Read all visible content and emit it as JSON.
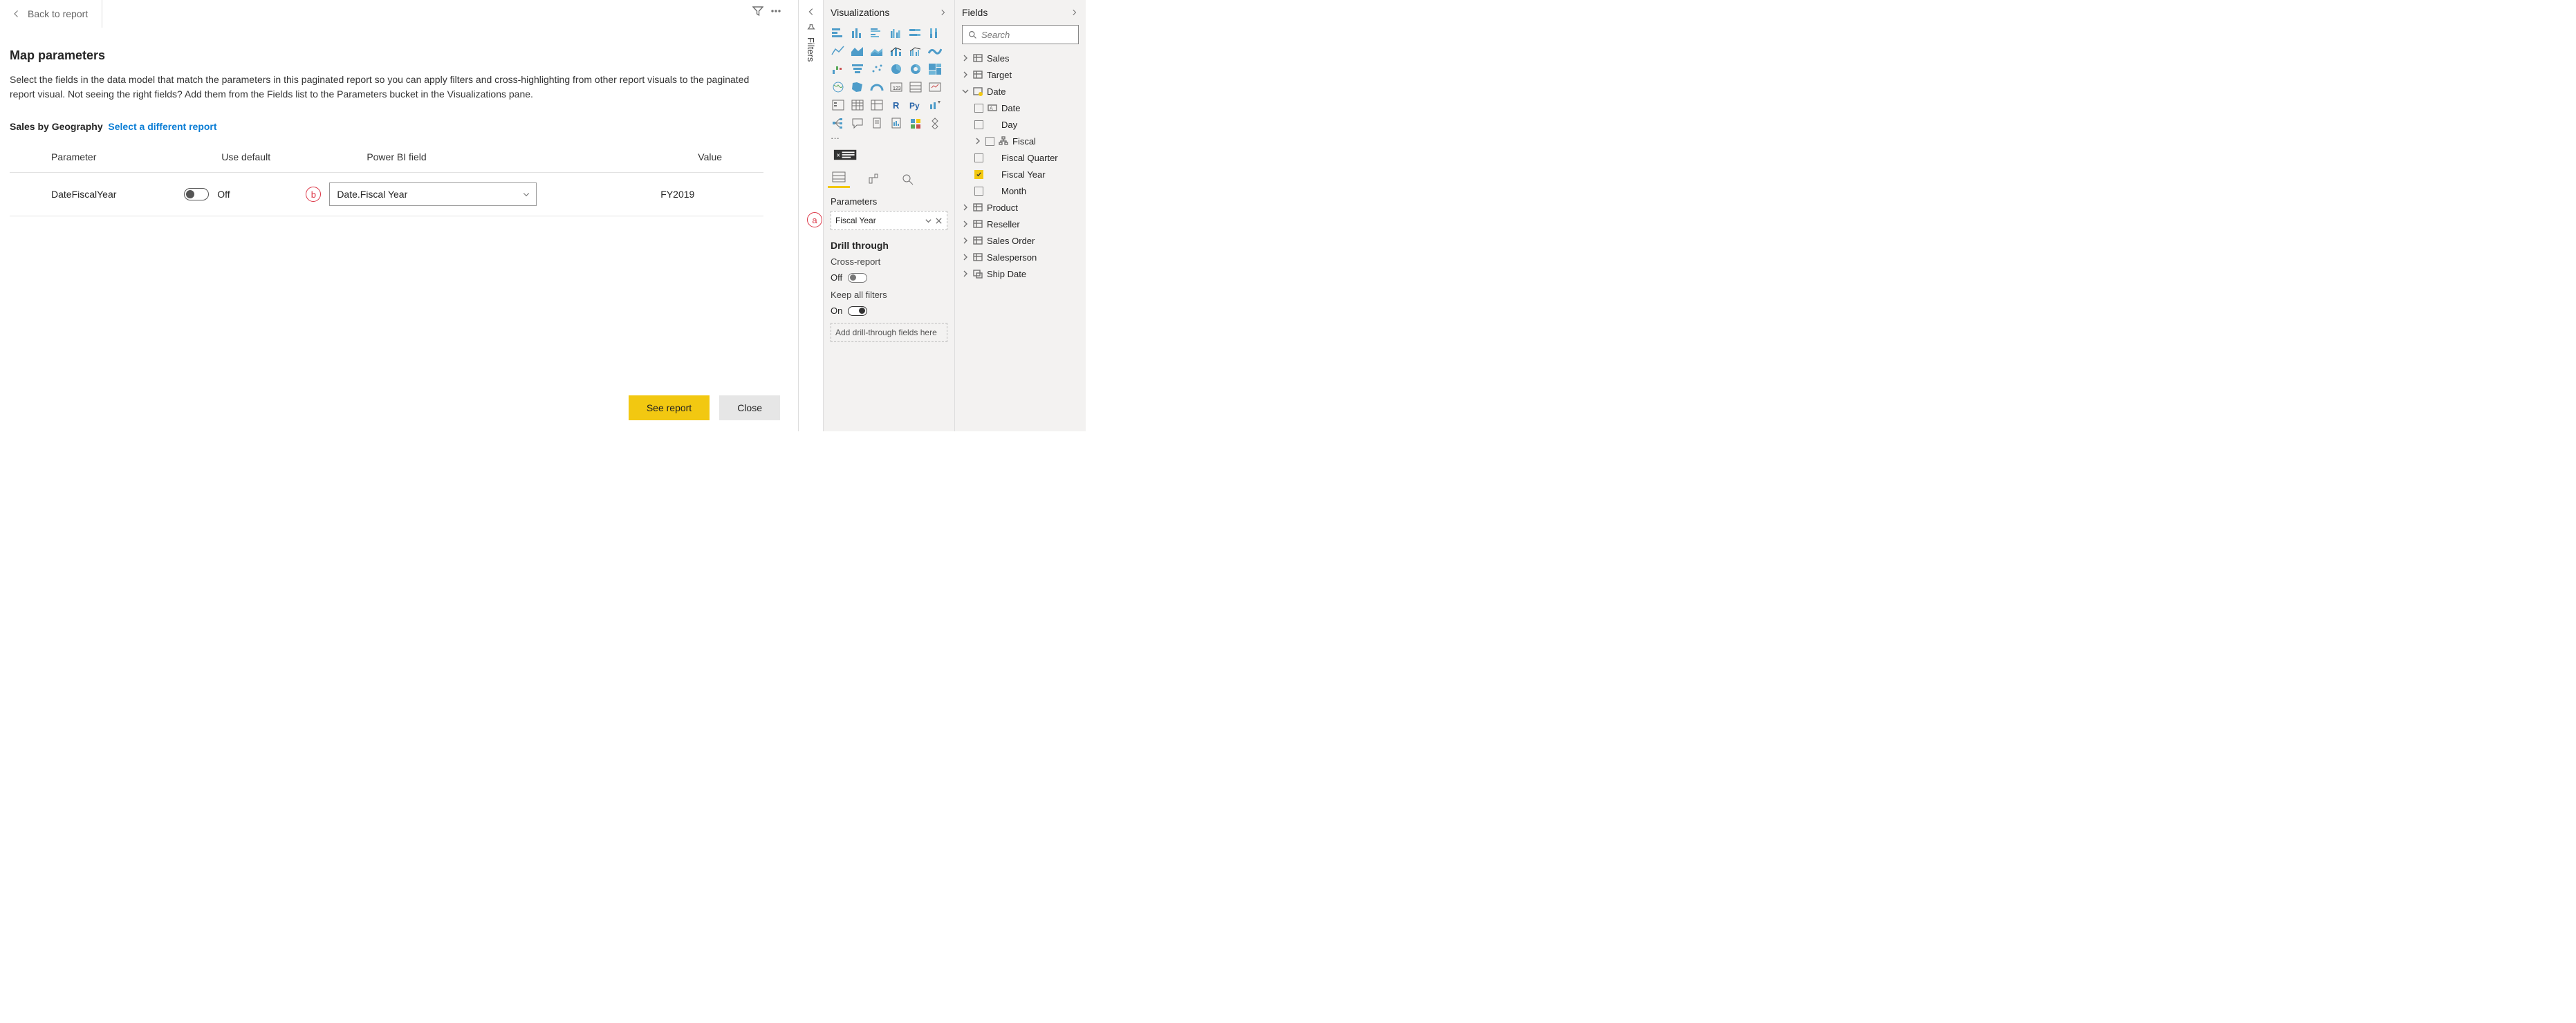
{
  "back": "Back to report",
  "topIcons": {
    "filter": "filter-icon",
    "more": "more-icon"
  },
  "page": {
    "title": "Map parameters",
    "desc": "Select the fields in the data model that match the parameters in this paginated report so you can apply filters and cross-highlighting from other report visuals to the paginated report visual. Not seeing the right fields? Add them from the Fields list to the Parameters bucket in the Visualizations pane.",
    "reportLabel": "Sales by Geography",
    "changeReport": "Select a different report"
  },
  "table": {
    "headers": {
      "param": "Parameter",
      "useDefault": "Use default",
      "field": "Power BI field",
      "value": "Value"
    },
    "rows": [
      {
        "param": "DateFiscalYear",
        "toggleLabel": "Off",
        "field": "Date.Fiscal Year",
        "value": "FY2019"
      }
    ]
  },
  "buttons": {
    "primary": "See report",
    "secondary": "Close"
  },
  "filtersRail": "Filters",
  "vizPane": {
    "title": "Visualizations",
    "paramsLabel": "Parameters",
    "paramPill": "Fiscal Year",
    "drill": "Drill through",
    "crossReport": "Cross-report",
    "crossReportState": "Off",
    "keepFilters": "Keep all filters",
    "keepFiltersState": "On",
    "dropzone": "Add drill-through fields here"
  },
  "fieldsPane": {
    "title": "Fields",
    "search": "Search",
    "tables": {
      "sales": "Sales",
      "target": "Target",
      "date": "Date",
      "dateFields": {
        "date": "Date",
        "day": "Day",
        "fiscal": "Fiscal",
        "fq": "Fiscal Quarter",
        "fy": "Fiscal Year",
        "month": "Month"
      },
      "product": "Product",
      "reseller": "Reseller",
      "salesOrder": "Sales Order",
      "salesperson": "Salesperson",
      "shipDate": "Ship Date"
    }
  },
  "annotations": {
    "a": "a",
    "b": "b"
  }
}
